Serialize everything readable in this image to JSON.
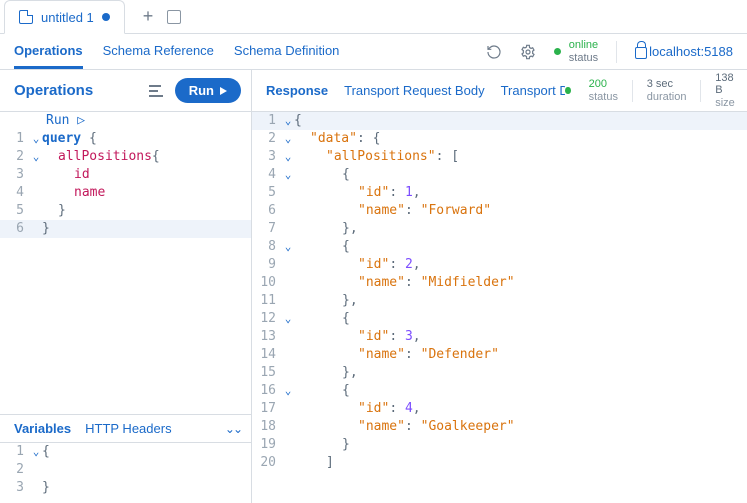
{
  "tab": {
    "title": "untitled 1"
  },
  "nav": {
    "tabs": [
      "Operations",
      "Schema Reference",
      "Schema Definition"
    ],
    "status_label": "status",
    "status_value": "online",
    "host": "localhost:5188"
  },
  "ops": {
    "title": "Operations",
    "run": "Run",
    "inline_run": "Run ▷"
  },
  "query": {
    "keyword": "query",
    "root": "allPositions",
    "fields": [
      "id",
      "name"
    ]
  },
  "vars": {
    "tab1": "Variables",
    "tab2": "HTTP Headers"
  },
  "resp": {
    "tabs": [
      "Response",
      "Transport Request Body",
      "Transport Deta"
    ],
    "code": "200",
    "code_label": "status",
    "duration": "3 sec",
    "duration_label": "duration",
    "size": "138 B",
    "size_label": "size"
  },
  "response_json": {
    "root_key": "data",
    "list_key": "allPositions",
    "items": [
      {
        "id": 1,
        "name": "Forward"
      },
      {
        "id": 2,
        "name": "Midfielder"
      },
      {
        "id": 3,
        "name": "Defender"
      },
      {
        "id": 4,
        "name": "Goalkeeper"
      }
    ]
  }
}
